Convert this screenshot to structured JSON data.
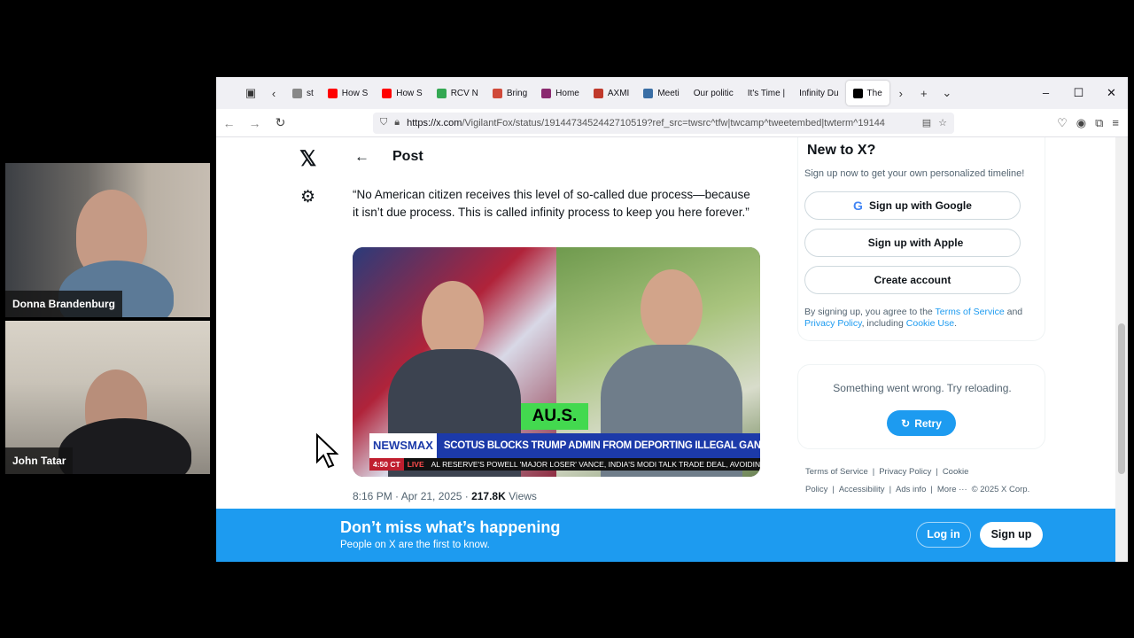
{
  "participants": [
    {
      "name": "Donna Brandenburg"
    },
    {
      "name": "John Tatar"
    }
  ],
  "browser": {
    "tabs": [
      {
        "label": "st",
        "icon": "tab-icon",
        "color": "#888888"
      },
      {
        "label": "How S",
        "icon": "youtube-icon",
        "color": "#ff0000"
      },
      {
        "label": "How S",
        "icon": "youtube-icon",
        "color": "#ff0000"
      },
      {
        "label": "RCV N",
        "icon": "google-drive-icon",
        "color": "#34a853"
      },
      {
        "label": "Bring",
        "icon": "document-icon",
        "color": "#d04a3a"
      },
      {
        "label": "Home",
        "icon": "home-icon",
        "color": "#8a2a6f"
      },
      {
        "label": "AXMI",
        "icon": "axmi-icon",
        "color": "#c0392b"
      },
      {
        "label": "Meeti",
        "icon": "globe-icon",
        "color": "#3a6ea5"
      },
      {
        "label": "Our politic",
        "icon": "",
        "color": ""
      },
      {
        "label": "It's Time |",
        "icon": "",
        "color": ""
      },
      {
        "label": "Infinity Du",
        "icon": "",
        "color": ""
      },
      {
        "label": "The",
        "icon": "x-icon",
        "color": "#000000"
      }
    ],
    "url": {
      "host": "https://x.com",
      "path": "/VigilantFox/status/1914473452442710519?ref_src=twsrc^tfw|twcamp^tweetembed|twterm^19144"
    }
  },
  "x_page": {
    "post_title": "Post",
    "tweet_text": "“No American citizen receives this level of so-called due process—because it isn’t due process. This is called infinity process to keep you here forever.”",
    "media": {
      "badge": "AU.S.",
      "network": "NEWSMAX",
      "headline": "SCOTUS BLOCKS TRUMP ADMIN FROM DEPORTING ILLEGAL GANG MEMBERS",
      "time": "4:50 CT",
      "live": "LIVE",
      "ticker": "AL RESERVE'S POWELL 'MAJOR LOSER'     VANCE, INDIA'S MODI TALK TRADE DEAL, AVOIDIN"
    },
    "meta_time": "8:16 PM · Apr 21, 2025 · ",
    "meta_views": "217.8K",
    "meta_views_label": " Views",
    "sidebar": {
      "title": "New to X?",
      "subtitle": "Sign up now to get your own personalized timeline!",
      "google_btn": "Sign up with Google",
      "apple_btn": "Sign up with Apple",
      "create_btn": "Create account",
      "legal_prefix": "By signing up, you agree to the ",
      "tos": "Terms of Service",
      "and": " and ",
      "privacy": "Privacy Policy",
      "including": ", including ",
      "cookie": "Cookie Use",
      "period": "."
    },
    "error": {
      "message": "Something went wrong. Try reloading.",
      "retry": "Retry"
    },
    "footer": [
      "Terms of Service",
      "|",
      "Privacy Policy",
      "|",
      "Cookie Policy",
      "|",
      "Accessibility",
      "|",
      "Ads info",
      "|",
      "More ···",
      "© 2025 X Corp."
    ],
    "banner": {
      "headline": "Don’t miss what’s happening",
      "sub": "People on X are the first to know.",
      "login": "Log in",
      "signup": "Sign up"
    }
  }
}
